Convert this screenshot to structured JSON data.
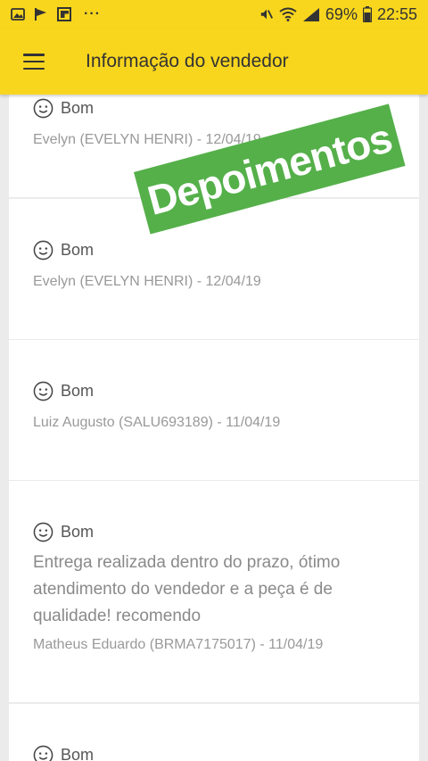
{
  "status_bar": {
    "icons_left": [
      "gallery-icon",
      "flag-icon",
      "flipboard-icon"
    ],
    "more": "···",
    "battery_percent": "69%",
    "time": "22:55"
  },
  "app_bar": {
    "title": "Informação do vendedor"
  },
  "overlay": {
    "stamp_text": "Depoimentos"
  },
  "reviews": [
    {
      "rating": "Bom",
      "comment": "",
      "author": "Evelyn (EVELYN HENRI) - 12/04/19"
    },
    {
      "rating": "Bom",
      "comment": "",
      "author": "Evelyn (EVELYN HENRI) - 12/04/19"
    },
    {
      "rating": "Bom",
      "comment": "",
      "author": "Luiz Augusto (SALU693189) - 11/04/19"
    },
    {
      "rating": "Bom",
      "comment": "Entrega realizada dentro do prazo, ótimo atendimento do vendedor e a peça é de qualidade! recomendo",
      "author": "Matheus Eduardo (BRMA7175017) - 11/04/19"
    },
    {
      "rating": "Bom",
      "comment": "",
      "author": ""
    }
  ],
  "colors": {
    "brand_yellow": "#f8d61e",
    "stamp_green": "#55b04a"
  }
}
